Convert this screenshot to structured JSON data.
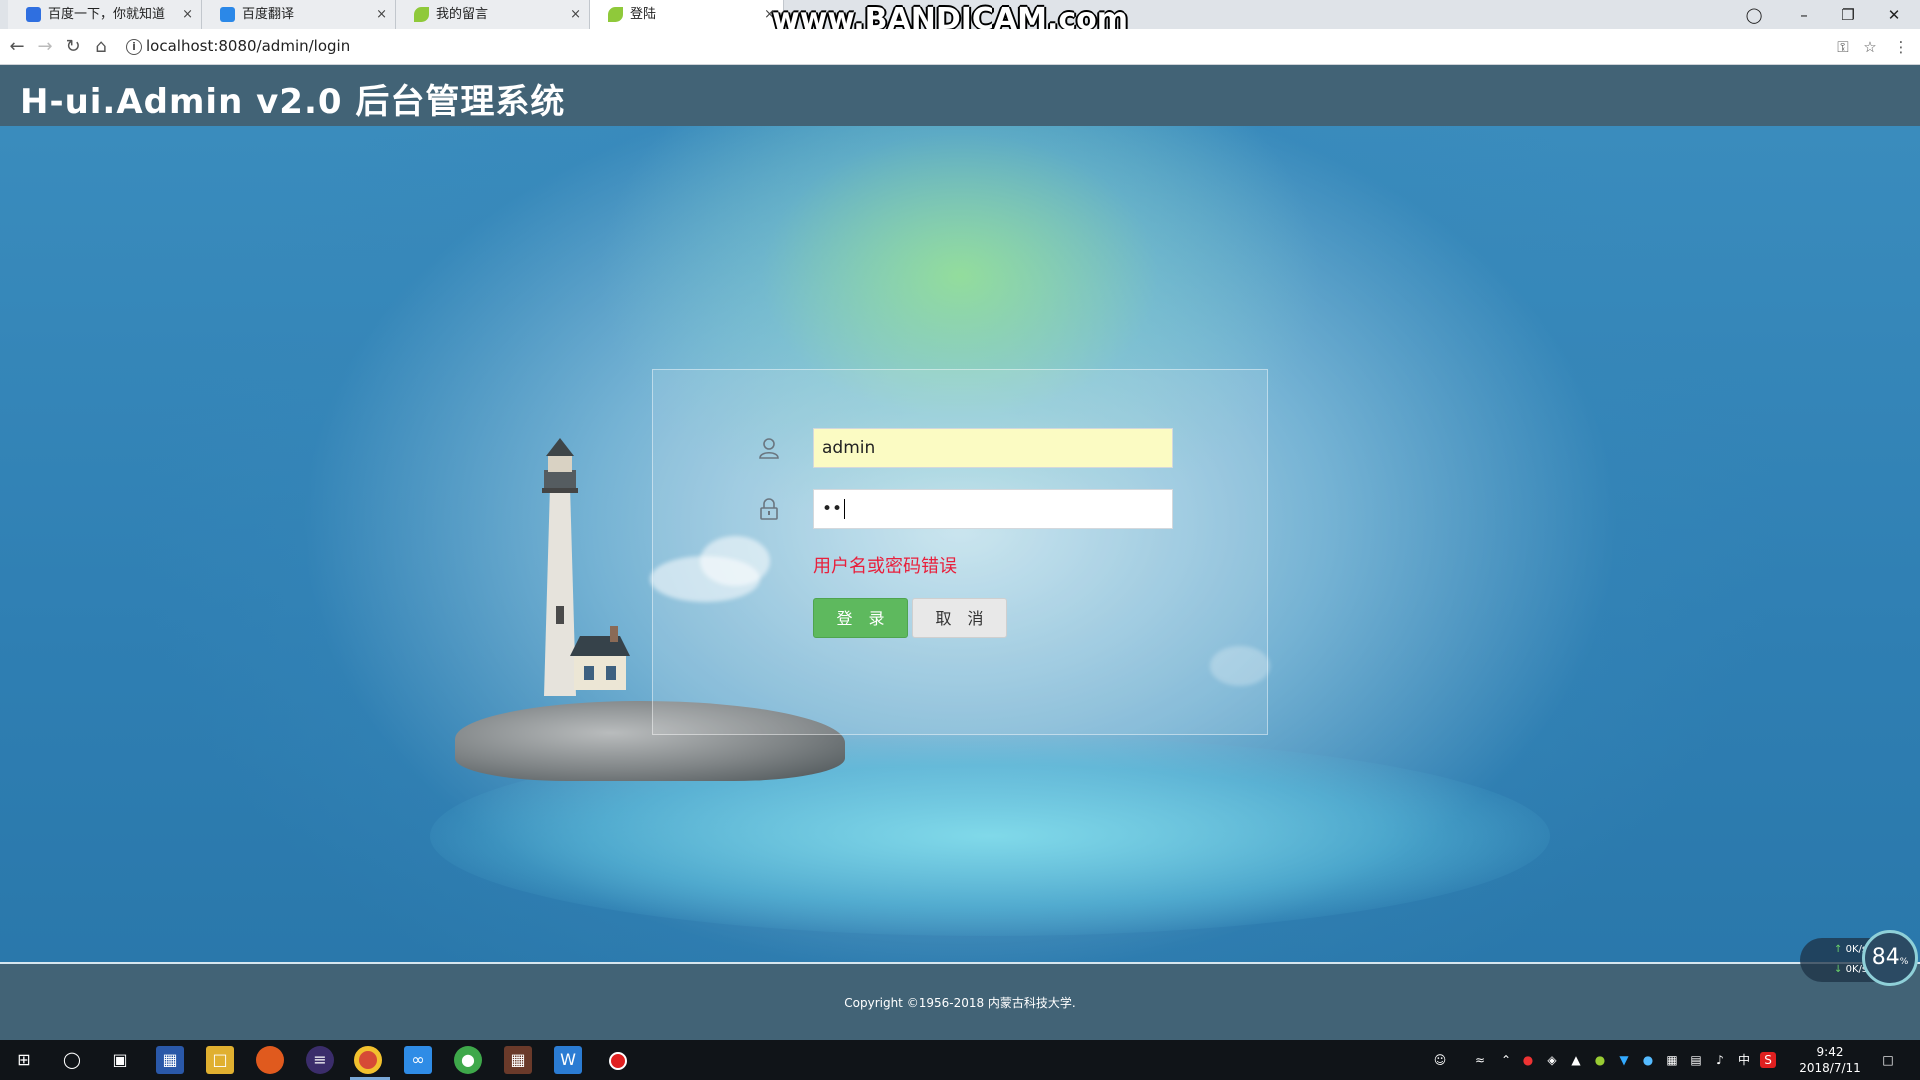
{
  "browser": {
    "tabs": [
      {
        "title": "百度一下，你就知道",
        "color": "#2f6fe0"
      },
      {
        "title": "百度翻译",
        "color": "#2b88e8"
      },
      {
        "title": "我的留言",
        "color": "#8fc93a"
      },
      {
        "title": "登陆",
        "color": "#8fc93a"
      }
    ],
    "close_glyph": "×",
    "watermark": "www.BANDICAM.com",
    "url": "localhost:8080/admin/login"
  },
  "header": {
    "title": "H-ui.Admin v2.0 后台管理系统"
  },
  "login": {
    "username_value": "admin",
    "password_value": "••",
    "error": "用户名或密码错误",
    "login_label": "登录",
    "cancel_label": "取消"
  },
  "footer": {
    "copyright": "Copyright ©1956-2018 内蒙古科技大学."
  },
  "net_widget": {
    "up": "0K/s",
    "down": "0K/s",
    "percent": "84",
    "percent_unit": "%"
  },
  "taskbar": {
    "time": "9:42",
    "date": "2018/7/11",
    "ime": "中"
  }
}
